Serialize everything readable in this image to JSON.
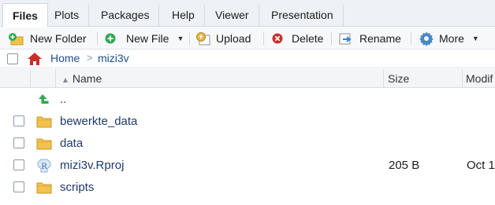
{
  "tabs": [
    {
      "label": "Files",
      "active": true
    },
    {
      "label": "Plots",
      "active": false
    },
    {
      "label": "Packages",
      "active": false
    },
    {
      "label": "Help",
      "active": false
    },
    {
      "label": "Viewer",
      "active": false
    },
    {
      "label": "Presentation",
      "active": false
    }
  ],
  "toolbar": {
    "new_folder": "New Folder",
    "new_file": "New File",
    "upload": "Upload",
    "delete": "Delete",
    "rename": "Rename",
    "more": "More"
  },
  "breadcrumb": {
    "home": "Home",
    "separator": ">",
    "current": "mizi3v"
  },
  "columns": {
    "name": "Name",
    "size": "Size",
    "modified": "Modif"
  },
  "files": [
    {
      "name": "..",
      "icon": "parent-folder-icon",
      "size": "",
      "modified": ""
    },
    {
      "name": "bewerkte_data",
      "icon": "folder-icon",
      "size": "",
      "modified": ""
    },
    {
      "name": "data",
      "icon": "folder-icon",
      "size": "",
      "modified": ""
    },
    {
      "name": "mizi3v.Rproj",
      "icon": "rproj-icon",
      "size": "205 B",
      "modified": "Oct 1"
    },
    {
      "name": "scripts",
      "icon": "folder-icon",
      "size": "",
      "modified": ""
    }
  ],
  "colors": {
    "folder": "#f2c14e",
    "link": "#1f4e8f",
    "parent_arrow": "#2faa55"
  }
}
